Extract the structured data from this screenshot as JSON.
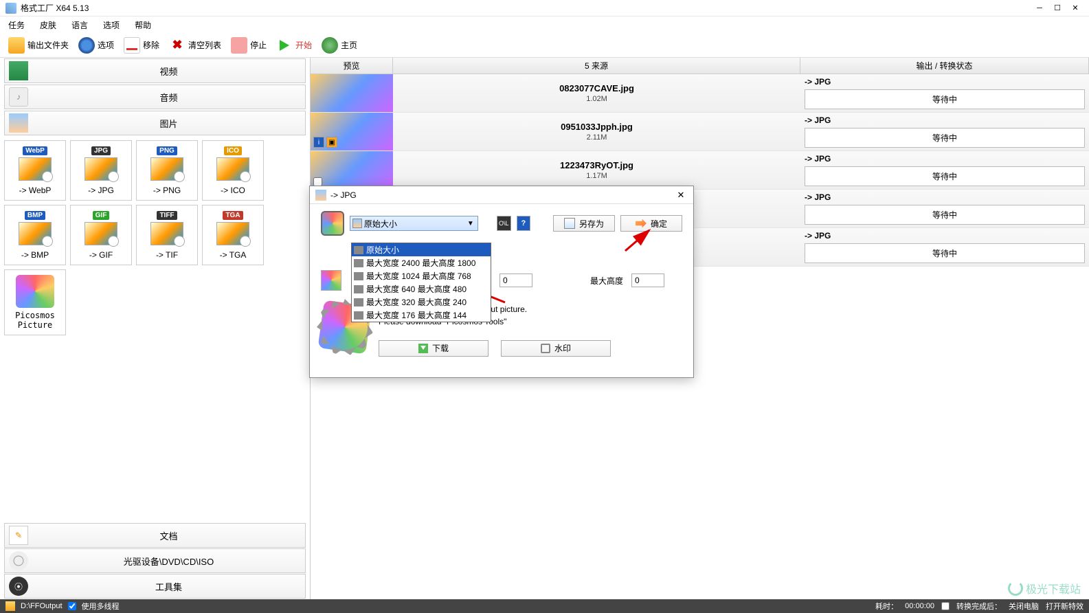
{
  "app": {
    "title": "格式工厂 X64 5.13"
  },
  "menu": [
    "任务",
    "皮肤",
    "语言",
    "选项",
    "帮助"
  ],
  "toolbar": {
    "output_folder": "输出文件夹",
    "options": "选项",
    "remove": "移除",
    "clear": "清空列表",
    "stop": "停止",
    "start": "开始",
    "home": "主页"
  },
  "categories": {
    "video": "视频",
    "audio": "音频",
    "image": "图片",
    "document": "文档",
    "disc": "光驱设备\\DVD\\CD\\ISO",
    "tools": "工具集"
  },
  "formats": [
    {
      "badge": "WebP",
      "badgeColor": "#1e5bbf",
      "label": "-> WebP"
    },
    {
      "badge": "JPG",
      "badgeColor": "#333",
      "label": "-> JPG"
    },
    {
      "badge": "PNG",
      "badgeColor": "#1e5bbf",
      "label": "-> PNG"
    },
    {
      "badge": "ICO",
      "badgeColor": "#e59b00",
      "label": "-> ICO"
    },
    {
      "badge": "BMP",
      "badgeColor": "#1e5bbf",
      "label": "-> BMP"
    },
    {
      "badge": "GIF",
      "badgeColor": "#2aa52a",
      "label": "-> GIF"
    },
    {
      "badge": "TIFF",
      "badgeColor": "#333",
      "label": "-> TIF"
    },
    {
      "badge": "TGA",
      "badgeColor": "#c0392b",
      "label": "-> TGA"
    }
  ],
  "picosmos": "Picosmos\nPicture",
  "grid": {
    "headers": {
      "preview": "预览",
      "source": "5 来源",
      "output": "输出 / 转换状态"
    },
    "rows": [
      {
        "file": "0823077CAVE.jpg",
        "size": "1.02M",
        "out": "-> JPG",
        "status": "等待中"
      },
      {
        "file": "0951033Jpph.jpg",
        "size": "2.11M",
        "out": "-> JPG",
        "status": "等待中"
      },
      {
        "file": "1223473RyOT.jpg",
        "size": "1.17M",
        "out": "-> JPG",
        "status": "等待中"
      },
      {
        "file": "",
        "size": "",
        "out": "-> JPG",
        "status": "等待中"
      },
      {
        "file": "",
        "size": "",
        "out": "-> JPG",
        "status": "等待中"
      }
    ]
  },
  "dialog": {
    "title": "-> JPG",
    "combo_text": "原始大小",
    "save_as": "另存为",
    "ok": "确定",
    "options": [
      "原始大小",
      "最大宽度 2400 最大高度 1800",
      "最大宽度 1024 最大高度 768",
      "最大宽度 640 最大高度 480",
      "最大宽度 320 最大高度 240",
      "最大宽度 176 最大高度 144"
    ],
    "max_w_label": "宽度",
    "max_w_value": "0",
    "max_h_label": "最大高度",
    "max_h_value": "0",
    "info1": "If you want more functions about picture.",
    "info2": "Please download \"Picosmos Tools\"",
    "download": "下载",
    "watermark": "水印"
  },
  "status": {
    "path": "D:\\FFOutput",
    "multithread": "使用多线程",
    "elapsed_label": "耗时：",
    "elapsed": "00:00:00",
    "after_label": "转换完成后：",
    "after_value": "关闭电脑",
    "switch": "打开新特效"
  },
  "watermark": "极光下载站"
}
